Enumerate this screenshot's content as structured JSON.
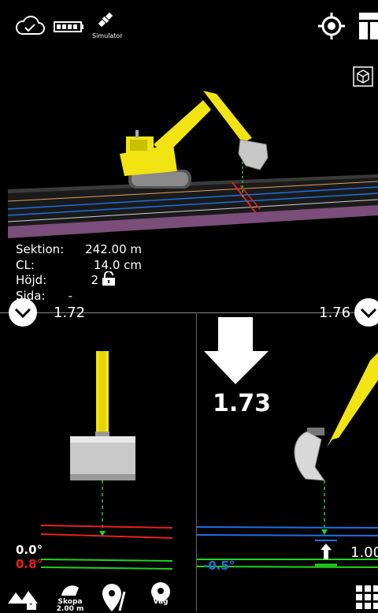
{
  "status_bar": {
    "simulator_label": "Simulator"
  },
  "info": {
    "sektion_label": "Sektion:",
    "sektion_value": "242.00 m",
    "cl_label": "CL:",
    "cl_value": "14.0 cm",
    "hojd_label": "Höjd:",
    "hojd_value": "2",
    "sida_label": "Sida:",
    "sida_value": "-"
  },
  "left_panel": {
    "header_value": "1.72",
    "slope_top": "0.0°",
    "slope_bottom": "0.8°"
  },
  "right_panel": {
    "header_value": "1.76",
    "cut_value": "1.73",
    "slope": "-0.5°",
    "side_value": "1.00"
  },
  "bottom_bar": {
    "skopa_label": "Skopa",
    "skopa_value": "2.00 m",
    "vag_label": "Väg"
  },
  "colors": {
    "excavator_yellow": "#f2e313",
    "red_line": "#e8201c",
    "green_line": "#1fd41c",
    "blue_line": "#1e6fe0",
    "slope_blue": "#1e6fe0",
    "slope_red": "#e8201c"
  }
}
